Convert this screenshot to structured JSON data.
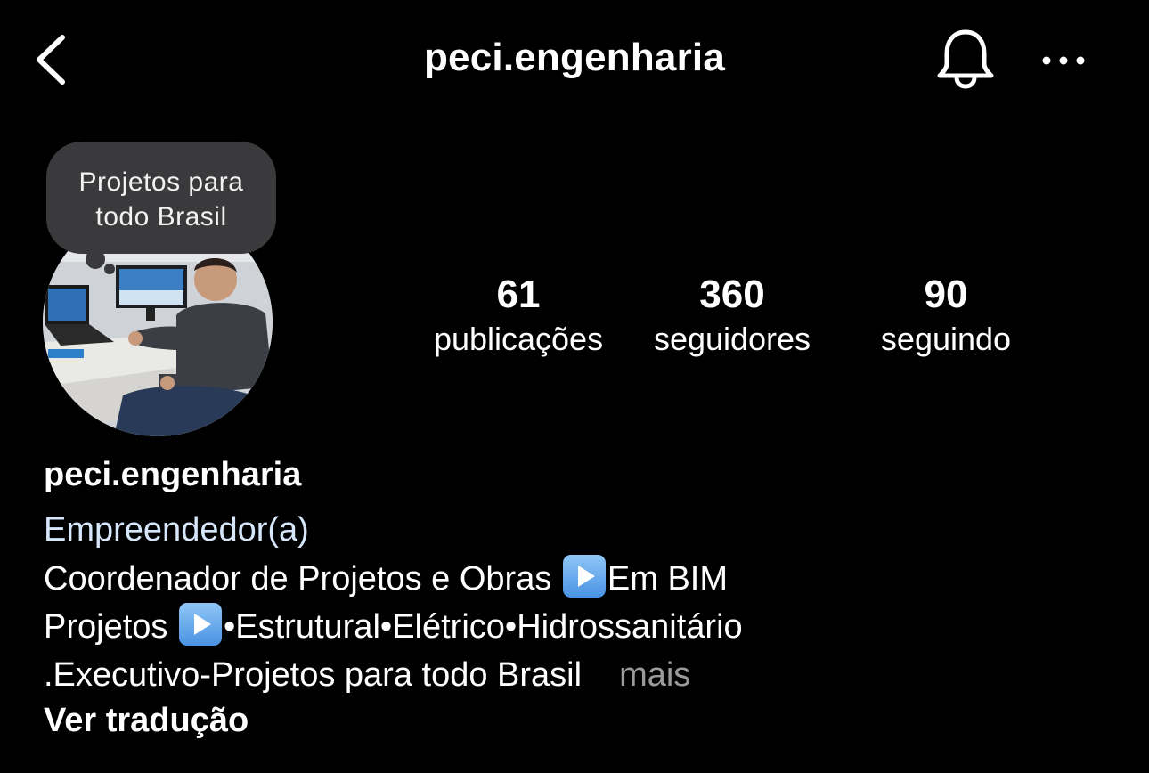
{
  "header": {
    "username": "peci.engenharia",
    "back_icon": "chevron-left-icon",
    "notifications_icon": "bell-icon",
    "more_icon": "ellipsis-icon"
  },
  "profile": {
    "note": "Projetos para todo Brasil",
    "username": "peci.engenharia",
    "category": "Empreendedor(a)",
    "stats": [
      {
        "value": "61",
        "label": "publicações"
      },
      {
        "value": "360",
        "label": "seguidores"
      },
      {
        "value": "90",
        "label": "seguindo"
      }
    ],
    "bio": {
      "line1_a": "Coordenador de Projetos e Obras ",
      "line1_b": "Em BIM",
      "line2_a": "Projetos ",
      "line2_b": "•Estrutural•Elétrico•Hidrossanitário",
      "line3": ".Executivo-Projetos para todo Brasil",
      "more_label": "mais"
    },
    "translate_label": "Ver tradução"
  },
  "colors": {
    "background": "#000000",
    "category": "#d6e6fb",
    "muted": "#9a9a9a",
    "note_bubble": "#3a3a3c"
  }
}
